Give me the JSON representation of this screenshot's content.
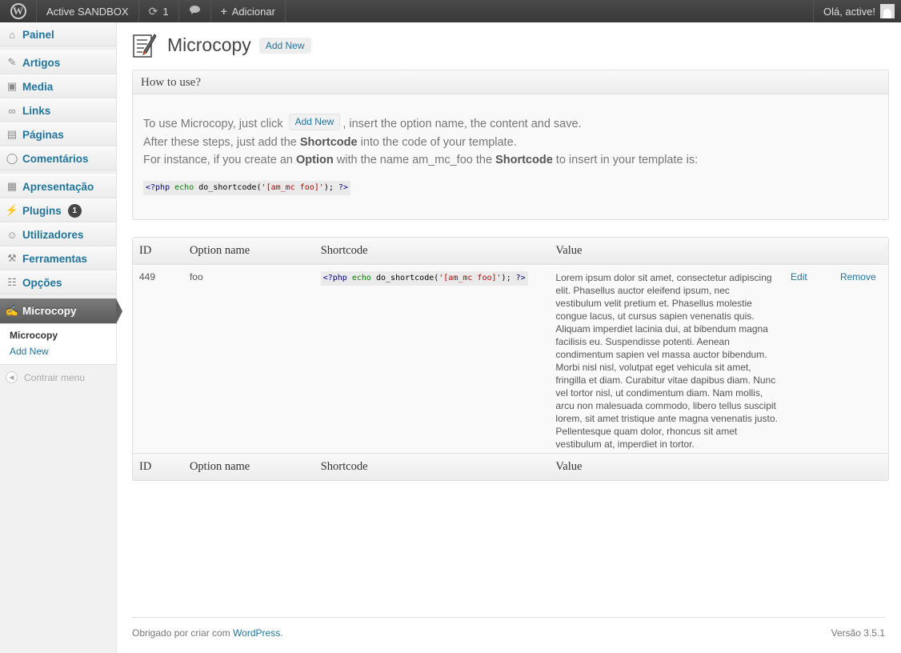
{
  "adminbar": {
    "site_name": "Active SANDBOX",
    "updates_count": "1",
    "add_label": "Adicionar",
    "greeting": "Olá, active!"
  },
  "sidebar": {
    "items": [
      {
        "label": "Painel",
        "icon": "dashboard-icon"
      },
      {
        "label": "Artigos",
        "icon": "pin-icon"
      },
      {
        "label": "Media",
        "icon": "media-icon"
      },
      {
        "label": "Links",
        "icon": "link-icon"
      },
      {
        "label": "Páginas",
        "icon": "pages-icon"
      },
      {
        "label": "Comentários",
        "icon": "comment-icon"
      },
      {
        "label": "Apresentação",
        "icon": "appearance-icon"
      },
      {
        "label": "Plugins",
        "icon": "plugin-icon",
        "badge": "1"
      },
      {
        "label": "Utilizadores",
        "icon": "users-icon"
      },
      {
        "label": "Ferramentas",
        "icon": "tools-icon"
      },
      {
        "label": "Opções",
        "icon": "settings-icon"
      },
      {
        "label": "Microcopy",
        "icon": "microcopy-icon"
      }
    ],
    "submenu": {
      "current": "Microcopy",
      "add_new": "Add New"
    },
    "collapse_label": "Contrair menu"
  },
  "page": {
    "title": "Microcopy",
    "add_new": "Add New"
  },
  "howto": {
    "title": "How to use?",
    "line1_before": "To use Microcopy, just click",
    "line1_button": "Add New",
    "line1_after": ", insert the option name, the content and save.",
    "line2_before": "After these steps, just add the",
    "line2_bold": "Shortcode",
    "line2_after": "into the code of your template.",
    "line3_a": "For instance, if you create an",
    "line3_b": "Option",
    "line3_c": "with the name am_mc_foo the",
    "line3_d": "Shortcode",
    "line3_e": "to insert in your template is:",
    "code": {
      "open": "<?php",
      "echo": "echo",
      "fn": "do_shortcode(",
      "str": "'[am_mc foo]'",
      "close_paren": ");",
      "close": "?>"
    }
  },
  "table": {
    "columns": [
      "ID",
      "Option name",
      "Shortcode",
      "Value"
    ],
    "rows": [
      {
        "id": "449",
        "name": "foo",
        "code": {
          "open": "<?php",
          "echo": "echo",
          "fn": "do_shortcode(",
          "str": "'[am_mc foo]'",
          "close_paren": ");",
          "close": "?>"
        },
        "value": "Lorem ipsum dolor sit amet, consectetur adipiscing elit. Phasellus auctor eleifend ipsum, nec vestibulum velit pretium et. Phasellus molestie congue lacus, ut cursus sapien venenatis quis. Aliquam imperdiet lacinia dui, at bibendum magna facilisis eu. Suspendisse potenti. Aenean condimentum sapien vel massa auctor bibendum. Morbi nisl nisl, volutpat eget vehicula sit amet, fringilla et diam. Curabitur vitae dapibus diam. Nunc vel tortor nisl, ut condimentum diam. Nam mollis, arcu non malesuada commodo, libero tellus suscipit lorem, sit amet tristique ante magna venenatis justo. Pellentesque quam dolor, rhoncus sit amet vestibulum at, imperdiet in tortor.",
        "edit": "Edit",
        "remove": "Remove"
      }
    ]
  },
  "footer": {
    "thanks_prefix": "Obrigado por criar com",
    "thanks_link": "WordPress",
    "thanks_suffix": ".",
    "version": "Versão 3.5.1"
  }
}
